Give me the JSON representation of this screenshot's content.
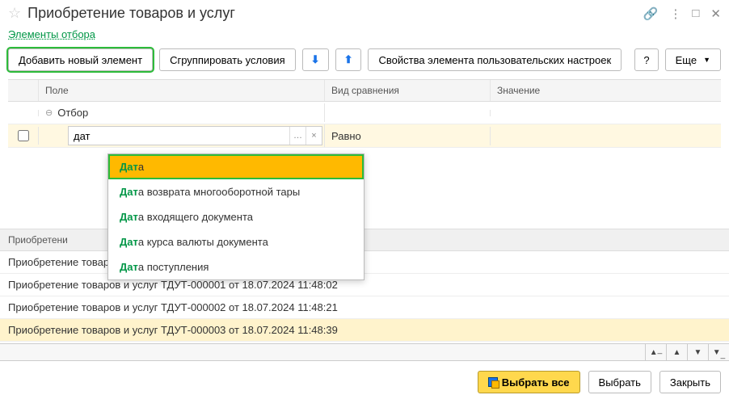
{
  "title": "Приобретение товаров и услуг",
  "subtitle": "Элементы отбора",
  "toolbar": {
    "add_new": "Добавить новый элемент",
    "group": "Сгруппировать условия",
    "props": "Свойства элемента пользовательских настроек",
    "help": "?",
    "more": "Еще"
  },
  "filter": {
    "headers": {
      "field": "Поле",
      "compare": "Вид сравнения",
      "value": "Значение"
    },
    "root_label": "Отбор",
    "edit": {
      "value": "дат",
      "compare": "Равно"
    }
  },
  "dropdown": {
    "items": [
      {
        "match": "Дат",
        "rest": "а"
      },
      {
        "match": "Дат",
        "rest": "а возврата многооборотной тары"
      },
      {
        "match": "Дат",
        "rest": "а входящего документа"
      },
      {
        "match": "Дат",
        "rest": "а курса валюты документа"
      },
      {
        "match": "Дат",
        "rest": "а поступления"
      }
    ]
  },
  "list": {
    "header": "Приобретени",
    "rows": [
      "Приобретение товаров и услуг ТД00-000043 от 15.05.2015 17:26:15",
      "Приобретение товаров и услуг ТДУТ-000001 от 18.07.2024 11:48:02",
      "Приобретение товаров и услуг ТДУТ-000002 от 18.07.2024 11:48:21",
      "Приобретение товаров и услуг ТДУТ-000003 от 18.07.2024 11:48:39"
    ]
  },
  "footer": {
    "select_all": "Выбрать все",
    "select": "Выбрать",
    "close": "Закрыть"
  }
}
